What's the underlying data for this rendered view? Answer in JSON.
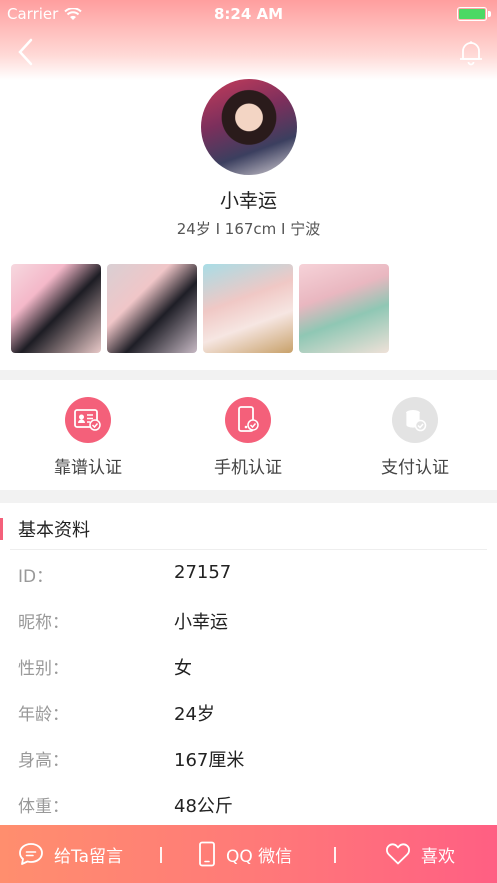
{
  "status_bar": {
    "carrier": "Carrier",
    "time": "8:24 AM"
  },
  "profile": {
    "nickname": "小幸运",
    "meta": "24岁 I 167cm I 宁波",
    "photos": [
      "photo-1",
      "photo-2",
      "photo-3",
      "photo-4"
    ]
  },
  "certifications": [
    {
      "label": "靠谱认证",
      "icon": "id-card-check-icon",
      "verified": true
    },
    {
      "label": "手机认证",
      "icon": "phone-check-icon",
      "verified": true
    },
    {
      "label": "支付认证",
      "icon": "coin-stack-check-icon",
      "verified": false
    }
  ],
  "basic_info": {
    "title": "基本资料",
    "rows": [
      {
        "label": "ID：",
        "value": "27157"
      },
      {
        "label": "昵称：",
        "value": "小幸运"
      },
      {
        "label": "性别：",
        "value": "女"
      },
      {
        "label": "年龄：",
        "value": "24岁"
      },
      {
        "label": "身高：",
        "value": "167厘米"
      },
      {
        "label": "体重：",
        "value": "48公斤"
      }
    ]
  },
  "bottom_bar": {
    "message_label": "给Ta留言",
    "contact_label": "QQ 微信",
    "like_label": "喜欢",
    "separator": "|"
  },
  "colors": {
    "accent": "#f4607a",
    "bar_start": "#ff8e6e",
    "bar_end": "#ff5f83"
  }
}
